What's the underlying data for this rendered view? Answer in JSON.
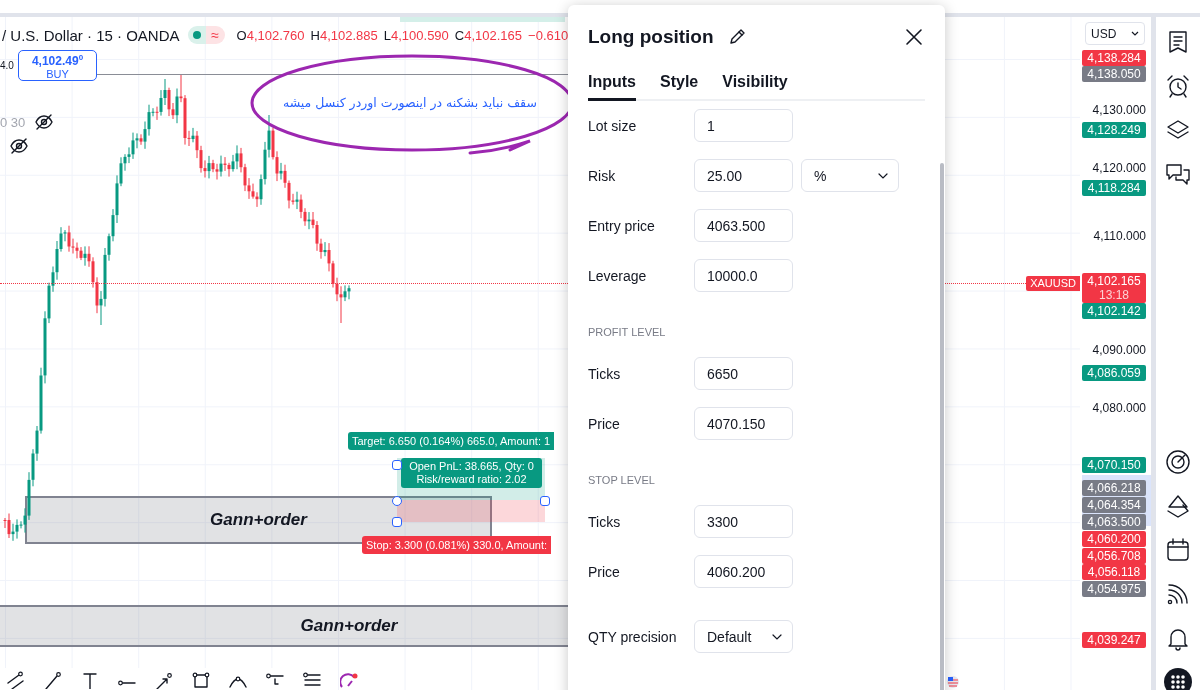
{
  "legend": {
    "title": "/ U.S. Dollar · 15 · OANDA",
    "status": "≈",
    "falling": true,
    "ohlc": [
      {
        "key": "O",
        "value": "4,102.760"
      },
      {
        "key": "H",
        "value": "4,102.885"
      },
      {
        "key": "L",
        "value": "4,100.590"
      },
      {
        "key": "C",
        "value": "4,102.165"
      }
    ],
    "change": "−0.610"
  },
  "chart": {
    "line_label": "4.0",
    "order": {
      "price": "4,102.49$^{0}$",
      "side": "BUY"
    },
    "hidden_indicators": [
      {
        "label": "0 30",
        "visible": false
      },
      {
        "visible": false
      }
    ],
    "note": "سقف نباید بشکنه در اینصورت اوردر کنسل میشه",
    "zones": [
      {
        "label": "Gann+order"
      },
      {
        "label": "Gann+order"
      }
    ],
    "position": {
      "target": "Target: 6.650 (0.164%) 665.0, Amount: 1",
      "stats": [
        "Open PnL: 38.665, Qty: 0",
        "Risk/reward ratio: 2.02"
      ],
      "stop": "Stop: 3.300 (0.081%) 330.0, Amount:"
    },
    "symbol_tag": "XAUUSD"
  },
  "price_axis": {
    "currency": "USD",
    "labels": [
      {
        "kind": "tag",
        "text": "4,138.284",
        "color": "#f23645"
      },
      {
        "kind": "tag",
        "text": "4,138.050",
        "color": "#787b86"
      },
      {
        "kind": "tick",
        "text": "4,130.000"
      },
      {
        "kind": "tag",
        "text": "4,128.249",
        "color": "#089981"
      },
      {
        "kind": "tick",
        "text": "4,120.000"
      },
      {
        "kind": "tag",
        "text": "4,118.284",
        "color": "#089981"
      },
      {
        "kind": "tick",
        "text": "4,110.000"
      },
      {
        "kind": "tag",
        "text": "4,102.165",
        "sub": "13:18",
        "color": "#f23645"
      },
      {
        "kind": "tag",
        "text": "4,102.142",
        "color": "#089981"
      },
      {
        "kind": "tick",
        "text": "4,090.000"
      },
      {
        "kind": "tag",
        "text": "4,086.059",
        "color": "#089981"
      },
      {
        "kind": "tick",
        "text": "4,080.000"
      },
      {
        "kind": "tag",
        "text": "4,070.150",
        "color": "#089981"
      },
      {
        "kind": "tag",
        "text": "4,066.218",
        "color": "#787b86"
      },
      {
        "kind": "tag",
        "text": "4,064.354",
        "color": "#787b86"
      },
      {
        "kind": "tag",
        "text": "4,063.500",
        "color": "#787b86"
      },
      {
        "kind": "tag",
        "text": "4,060.200",
        "color": "#f23645"
      },
      {
        "kind": "tag",
        "text": "4,056.708",
        "color": "#f23645"
      },
      {
        "kind": "tag",
        "text": "4,056.118",
        "color": "#f23645"
      },
      {
        "kind": "tag",
        "text": "4,054.975",
        "color": "#787b86"
      },
      {
        "kind": "tag",
        "text": "4,039.247",
        "color": "#f23645"
      }
    ]
  },
  "dialog": {
    "title": "Long position",
    "tabs": [
      {
        "label": "Inputs",
        "selected": true
      },
      {
        "label": "Style",
        "selected": false
      },
      {
        "label": "Visibility",
        "selected": false
      }
    ],
    "rows": [
      {
        "kind": "field",
        "label": "Lot size",
        "value": "1"
      },
      {
        "kind": "field",
        "label": "Risk",
        "value": "25.00",
        "unit": "%"
      },
      {
        "kind": "field",
        "label": "Entry price",
        "value": "4063.500"
      },
      {
        "kind": "field",
        "label": "Leverage",
        "value": "10000.0"
      },
      {
        "kind": "heading",
        "text": "PROFIT LEVEL"
      },
      {
        "kind": "field",
        "label": "Ticks",
        "value": "6650"
      },
      {
        "kind": "field",
        "label": "Price",
        "value": "4070.150"
      },
      {
        "kind": "heading",
        "text": "STOP LEVEL"
      },
      {
        "kind": "field",
        "label": "Ticks",
        "value": "3300"
      },
      {
        "kind": "field",
        "label": "Price",
        "value": "4060.200"
      },
      {
        "kind": "select",
        "label": "QTY precision",
        "value": "Default"
      }
    ]
  }
}
